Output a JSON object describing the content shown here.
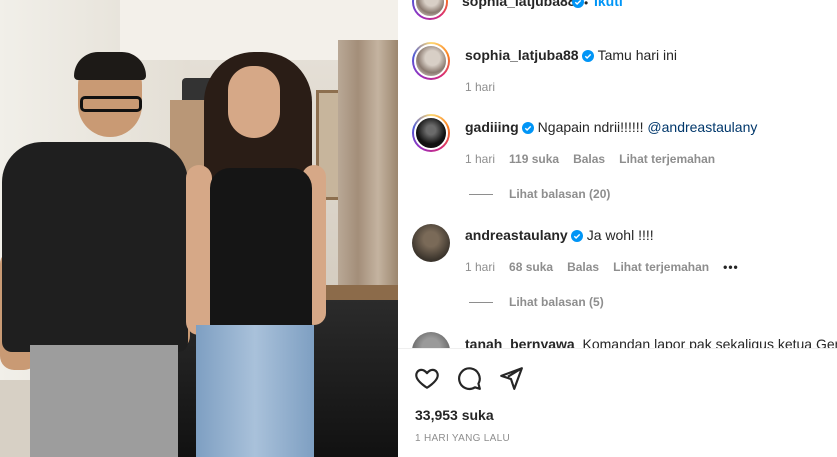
{
  "post_author": {
    "username": "sophia_latjuba88",
    "follow_label": "Ikuti",
    "separator": "•"
  },
  "comments": [
    {
      "username": "sophia_latjuba88",
      "verified": true,
      "text": "Tamu hari ini",
      "mention": "",
      "time": "1 hari",
      "likes": "",
      "reply_label": "",
      "translate_label": "",
      "view_replies": "",
      "avatar": "sophia-avatar-icon"
    },
    {
      "username": "gadiiing",
      "verified": true,
      "text": "Ngapain ndrii!!!!!!",
      "mention": "@andreastaulany",
      "time": "1 hari",
      "likes": "119 suka",
      "reply_label": "Balas",
      "translate_label": "Lihat terjemahan",
      "view_replies": "Lihat balasan (20)",
      "avatar": "gadiiing-avatar-icon"
    },
    {
      "username": "andreastaulany",
      "verified": true,
      "text": "Ja wohl !!!!",
      "mention": "",
      "time": "1 hari",
      "likes": "68 suka",
      "reply_label": "Balas",
      "translate_label": "Lihat terjemahan",
      "more": "•••",
      "view_replies": "Lihat balasan (5)",
      "avatar": "andreastaulany-avatar-icon"
    },
    {
      "username": "tanah_bernyawa",
      "verified": false,
      "text": "Komandan lapor pak sekaligus ketua Genk",
      "avatar": "tanah-bernyawa-avatar-icon"
    }
  ],
  "actions": {
    "like_icon": "heart-icon",
    "comment_icon": "comment-icon",
    "share_icon": "paper-plane-icon"
  },
  "likes_count": "33,953 suka",
  "post_date": "1 HARI YANG LALU",
  "colors": {
    "link_blue": "#0095f6",
    "mention_blue": "#00376b",
    "verified_blue": "#0095f6",
    "muted_gray": "#8e8e8e"
  }
}
